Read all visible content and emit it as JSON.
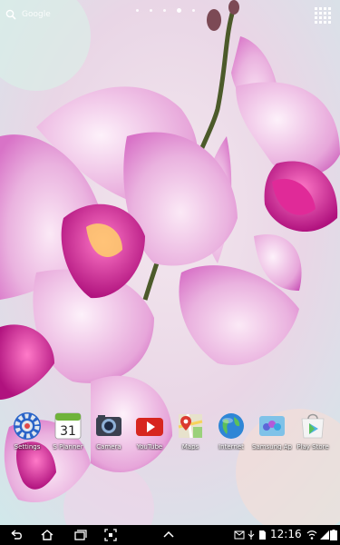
{
  "search": {
    "placeholder": "Google"
  },
  "home": {
    "page_count": 5,
    "active_page": 3
  },
  "dock": {
    "apps": [
      {
        "label": "Settings",
        "icon": "settings-icon"
      },
      {
        "label": "S Planner",
        "icon": "calendar-icon",
        "day": "31"
      },
      {
        "label": "Camera",
        "icon": "camera-icon"
      },
      {
        "label": "YouTube",
        "icon": "youtube-icon"
      },
      {
        "label": "Maps",
        "icon": "maps-icon"
      },
      {
        "label": "Internet",
        "icon": "globe-icon"
      },
      {
        "label": "Samsung Ap",
        "icon": "samsung-apps-icon"
      },
      {
        "label": "Play Store",
        "icon": "play-store-icon"
      }
    ]
  },
  "status": {
    "time": "12:16"
  },
  "colors": {
    "navbar": "#000000",
    "petal": "#e58ad6",
    "lip": "#c8158a"
  }
}
